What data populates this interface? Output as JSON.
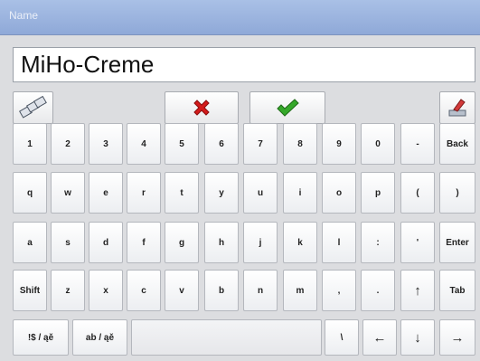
{
  "dialog": {
    "title": "Name"
  },
  "input": {
    "value": "MiHo-Creme"
  },
  "toolbar": {
    "left_icon": "keyboard-layout-icon",
    "cancel_icon": "red-x-icon",
    "ok_icon": "green-check-icon",
    "erase_icon": "eraser-icon",
    "colors": {
      "cancel": "#d41c1c",
      "ok": "#35a82a"
    }
  },
  "keyboard": {
    "rows": [
      [
        "1",
        "2",
        "3",
        "4",
        "5",
        "6",
        "7",
        "8",
        "9",
        "0",
        "-",
        "Back"
      ],
      [
        "q",
        "w",
        "e",
        "r",
        "t",
        "y",
        "u",
        "i",
        "o",
        "p",
        "(",
        ")"
      ],
      [
        "a",
        "s",
        "d",
        "f",
        "g",
        "h",
        "j",
        "k",
        "l",
        ":",
        "'",
        "Enter"
      ],
      [
        "Shift",
        "z",
        "x",
        "c",
        "v",
        "b",
        "n",
        "m",
        ",",
        ".",
        "↑",
        "Tab"
      ]
    ],
    "bottom": {
      "sym": "!$ / ąě",
      "abc": "ab / ąě",
      "space": "",
      "backslash": "\\",
      "left": "←",
      "down": "↓",
      "right": "→"
    }
  }
}
